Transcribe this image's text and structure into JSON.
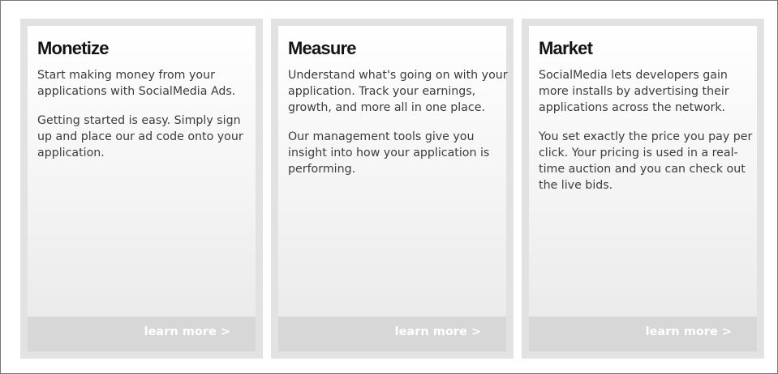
{
  "cards": [
    {
      "title": "Monetize",
      "paragraphs": [
        "Start making money from your applications with SocialMedia Ads.",
        "Getting started is easy. Simply sign up and place our ad code onto your application."
      ],
      "link_label": "learn more >"
    },
    {
      "title": "Measure",
      "paragraphs": [
        "Understand what's going on with your application. Track your earnings, growth, and more all in one place.",
        "Our management tools give you insight into how your application is performing."
      ],
      "link_label": "learn more >"
    },
    {
      "title": "Market",
      "paragraphs": [
        "SocialMedia lets developers gain more installs by advertising their applications across the network.",
        "You set exactly the price you pay per click. Your pricing is used in a real-time auction and you can check out the live bids."
      ],
      "link_label": "learn more >"
    }
  ]
}
